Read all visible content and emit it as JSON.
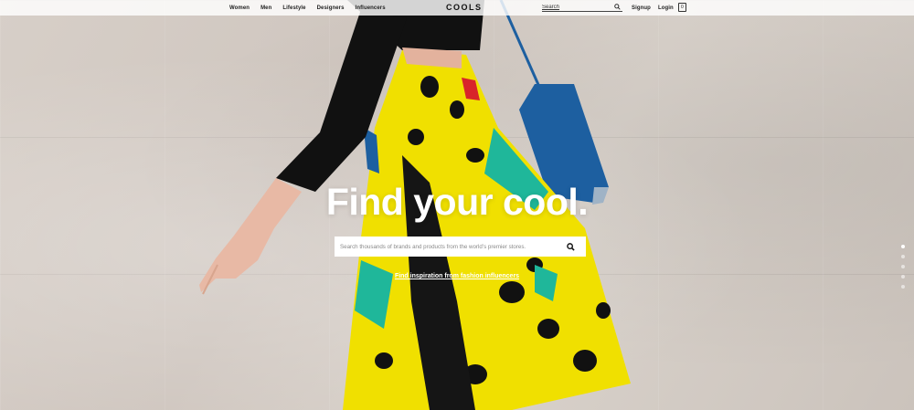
{
  "nav": {
    "women": "Women",
    "men": "Men",
    "lifestyle": "Lifestyle",
    "designers": "Designers",
    "influencers": "Influencers"
  },
  "brand": {
    "logo": "COOLS"
  },
  "search": {
    "placeholder": "Search"
  },
  "auth": {
    "signup": "Signup",
    "login": "Login"
  },
  "cart": {
    "count": "0"
  },
  "hero": {
    "headline": "Find your cool.",
    "search_placeholder": "Search thousands of brands and products from the world’s premier stores.",
    "inspiration_link": "Find inspiration from fashion influencers"
  },
  "pager": {
    "total": 5,
    "active_index": 0
  },
  "icons": {
    "search": "search-icon",
    "cart": "shopping-bag-icon"
  },
  "colors": {
    "skirt_yellow": "#f0e000",
    "bag_blue": "#1d5fa0",
    "teal": "#1fb79a"
  }
}
